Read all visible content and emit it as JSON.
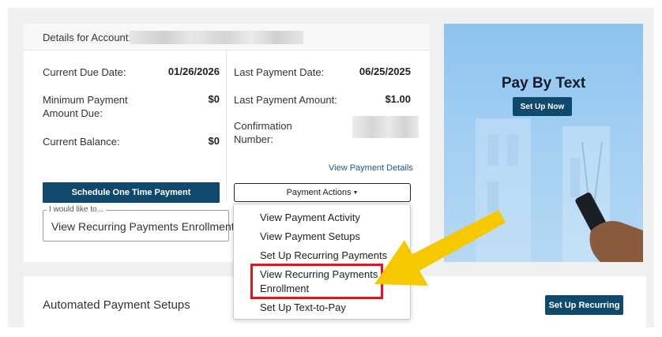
{
  "account": {
    "header_label": "Details for Account:"
  },
  "details": {
    "current_due_date_label": "Current Due Date:",
    "current_due_date_value": "01/26/2026",
    "minimum_payment_label": "Minimum Payment Amount Due:",
    "minimum_payment_value": "$0",
    "current_balance_label": "Current Balance:",
    "current_balance_value": "$0",
    "last_payment_date_label": "Last Payment Date:",
    "last_payment_date_value": "06/25/2025",
    "last_payment_amount_label": "Last Payment Amount:",
    "last_payment_amount_value": "$1.00",
    "confirmation_label": "Confirmation Number:",
    "view_payment_details_link": "View Payment Details"
  },
  "actions": {
    "schedule_button": "Schedule One Time Payment",
    "payment_actions_button": "Payment Actions",
    "caret_icon": "caret-down-icon",
    "i_would_like_legend": "I would like to...",
    "i_would_like_value": "View Recurring Payments Enrollment"
  },
  "dropdown_menu": {
    "items": [
      "View Payment Activity",
      "View Payment Setups",
      "Set Up Recurring Payments",
      "View Recurring Payments Enrollment",
      "Set Up Text-to-Pay"
    ]
  },
  "promo": {
    "title": "Pay By Text",
    "button": "Set Up Now"
  },
  "automated": {
    "title": "Automated Payment Setups",
    "button": "Set Up Recurring"
  },
  "colors": {
    "primary": "#0f4a6e",
    "highlight": "#e3171b",
    "arrow": "#f5c800"
  }
}
